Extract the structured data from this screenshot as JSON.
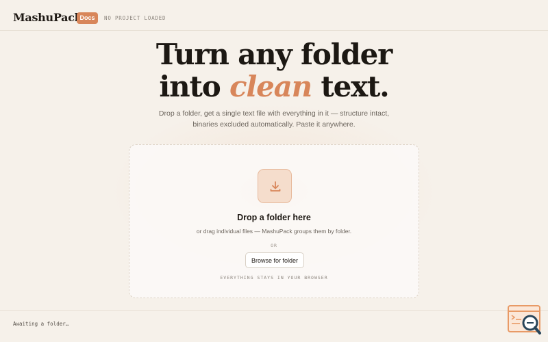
{
  "header": {
    "brand": "MashuPack",
    "docs_label": "Docs",
    "project_status": "NO PROJECT LOADED"
  },
  "hero": {
    "title_line1": "Turn any folder",
    "title_prefix": "into",
    "title_accent": "clean",
    "title_suffix": "text.",
    "subtitle": "Drop a folder, get a single text file with everything in it — structure intact, binaries excluded automatically. Paste it anywhere."
  },
  "dropzone": {
    "icon": "download-icon",
    "title": "Drop a folder here",
    "hint": "or drag individual files — MashuPack groups them by folder.",
    "or_label": "OR",
    "browse_label": "Browse for folder",
    "privacy_note": "EVERYTHING STAYS IN YOUR BROWSER"
  },
  "footer": {
    "status": "Awaiting a folder…"
  },
  "widget": {
    "icon": "search-code-icon"
  },
  "colors": {
    "accent": "#d8865a",
    "background": "#f6f1ea",
    "text": "#1f1a15"
  }
}
